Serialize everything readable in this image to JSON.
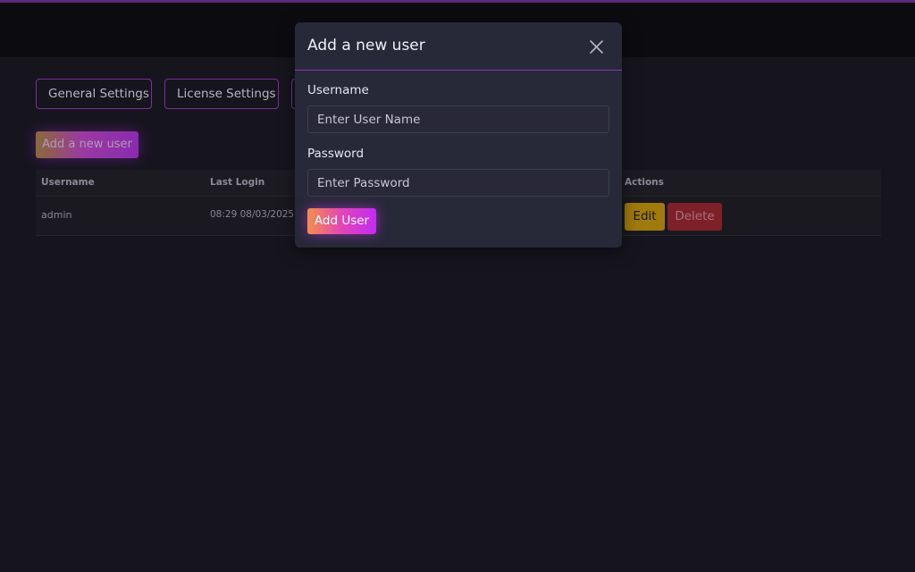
{
  "tabs": [
    {
      "label": "General Settings"
    },
    {
      "label": "License Settings"
    },
    {
      "label": ""
    }
  ],
  "add_user_button": "Add a new user",
  "table": {
    "headers": [
      "Username",
      "Last Login",
      "Actions"
    ],
    "rows": [
      {
        "username": "admin",
        "last_login": "08:29 08/03/2025",
        "edit": "Edit",
        "delete": "Delete"
      }
    ]
  },
  "modal": {
    "title": "Add a new user",
    "username_label": "Username",
    "username_placeholder": "Enter User Name",
    "password_label": "Password",
    "password_placeholder": "Enter Password",
    "submit_label": "Add User",
    "close_icon": "close-icon"
  },
  "colors": {
    "accent": "#8a34b8",
    "edit": "#a07a0c",
    "delete": "#7e2028"
  }
}
